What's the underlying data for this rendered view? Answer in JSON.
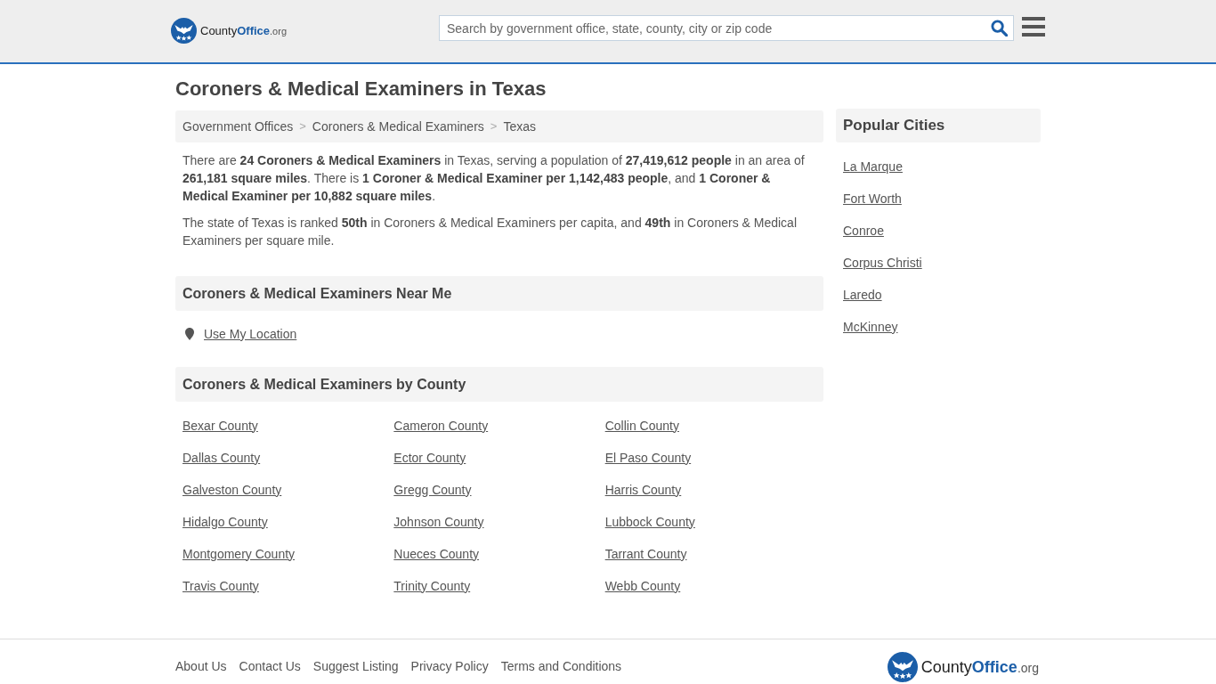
{
  "header": {
    "logo": {
      "name": "County",
      "highlight": "Office",
      "suffix": ".org"
    },
    "search": {
      "placeholder": "Search by government office, state, county, city or zip code"
    }
  },
  "page_title": "Coroners & Medical Examiners in Texas",
  "breadcrumb": [
    {
      "label": "Government Offices",
      "separator": ">"
    },
    {
      "label": "Coroners & Medical Examiners",
      "separator": ">"
    },
    {
      "label": "Texas"
    }
  ],
  "summary": [
    "There are **24 Coroners & Medical Examiners** in Texas, serving a population of **27,419,612 people** in an area of **261,181 square miles**. There is **1 Coroner & Medical Examiner per 1,142,483 people**, and **1 Coroner & Medical Examiner per 10,882 square miles**.",
    "The state of Texas is ranked **50th** in Coroners & Medical Examiners per capita, and **49th** in Coroners & Medical Examiners per square mile."
  ],
  "near_me": {
    "heading": "Coroners & Medical Examiners Near Me",
    "location_link": "Use My Location"
  },
  "by_county": {
    "heading": "Coroners & Medical Examiners by County",
    "counties": [
      "Bexar County",
      "Cameron County",
      "Collin County",
      "Dallas County",
      "Ector County",
      "El Paso County",
      "Galveston County",
      "Gregg County",
      "Harris County",
      "Hidalgo County",
      "Johnson County",
      "Lubbock County",
      "Montgomery County",
      "Nueces County",
      "Tarrant County",
      "Travis County",
      "Trinity County",
      "Webb County"
    ]
  },
  "popular_cities": {
    "heading": "Popular Cities",
    "cities": [
      "La Marque",
      "Fort Worth",
      "Conroe",
      "Corpus Christi",
      "Laredo",
      "McKinney"
    ]
  },
  "footer": {
    "links": [
      "About Us",
      "Contact Us",
      "Suggest Listing",
      "Privacy Policy",
      "Terms and Conditions"
    ],
    "logo": {
      "name": "County",
      "highlight": "Office",
      "suffix": ".org"
    }
  }
}
